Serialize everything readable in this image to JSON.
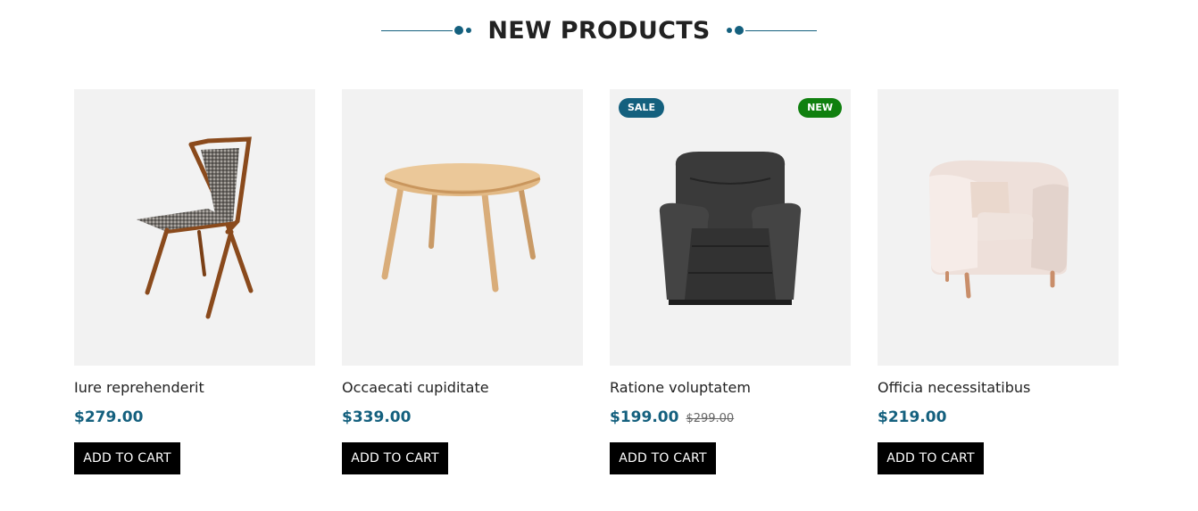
{
  "section": {
    "title": "NEW PRODUCTS",
    "accent_color": "#14607e"
  },
  "products": [
    {
      "name": "Iure reprehenderit",
      "price": "$279.00",
      "old_price": "",
      "badges": [],
      "image": "wooden-chair-icon",
      "button": "ADD TO CART"
    },
    {
      "name": "Occaecati cupiditate",
      "price": "$339.00",
      "old_price": "",
      "badges": [],
      "image": "round-table-icon",
      "button": "ADD TO CART"
    },
    {
      "name": "Ratione voluptatem",
      "price": "$199.00",
      "old_price": "$299.00",
      "badges": [
        "SALE",
        "NEW"
      ],
      "image": "leather-recliner-icon",
      "button": "ADD TO CART"
    },
    {
      "name": "Officia necessitatibus",
      "price": "$219.00",
      "old_price": "",
      "badges": [],
      "image": "tub-armchair-icon",
      "button": "ADD TO CART"
    }
  ],
  "badge_labels": {
    "sale": "SALE",
    "new": "NEW"
  },
  "colors": {
    "sale_badge": "#14607e",
    "new_badge": "#10800f",
    "price": "#14607e",
    "button_bg": "#000000"
  }
}
